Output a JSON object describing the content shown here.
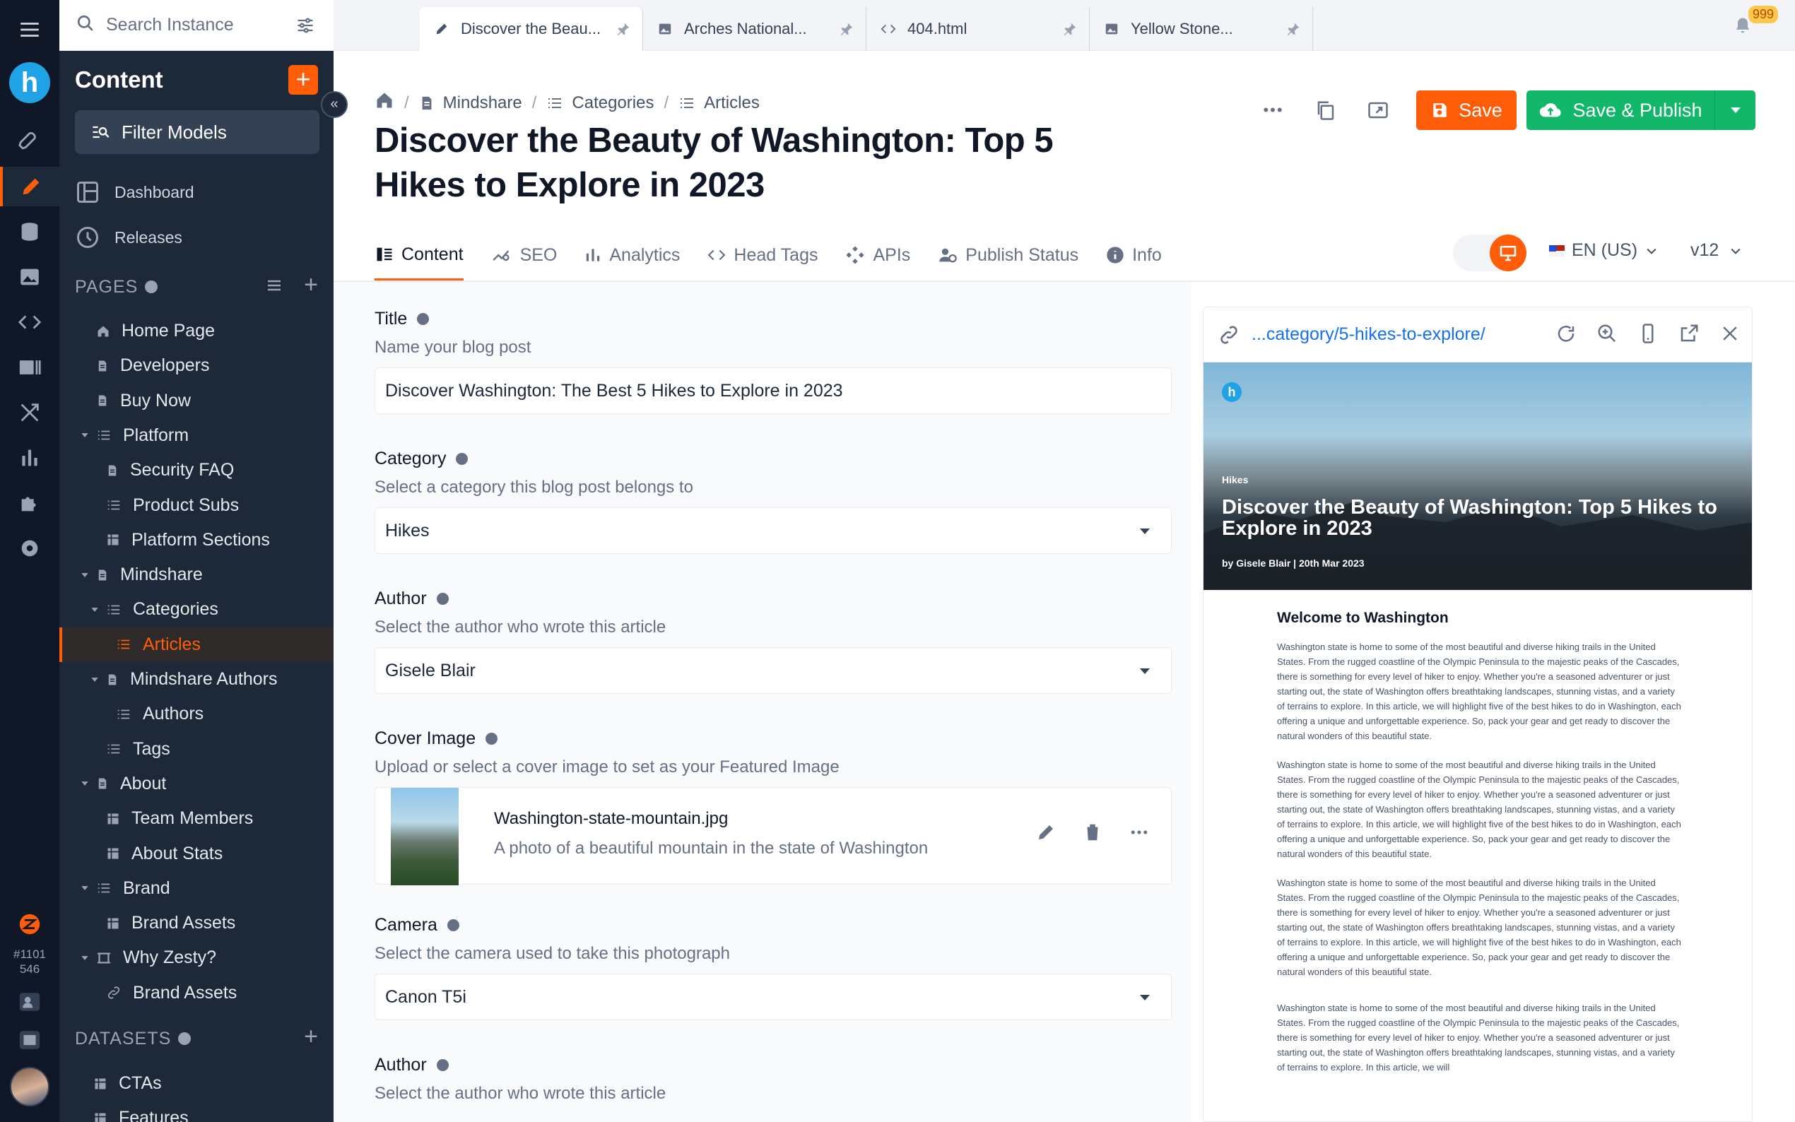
{
  "rail": {
    "instance_id": "#1101\n546"
  },
  "sidebar": {
    "search_placeholder": "Search Instance",
    "content_title": "Content",
    "add_label": "+",
    "filter_models": "Filter Models",
    "links": [
      {
        "label": "Dashboard",
        "icon": "dashboard-icon"
      },
      {
        "label": "Releases",
        "icon": "history-icon"
      }
    ],
    "pages_heading": "PAGES",
    "tree": [
      {
        "label": "Home Page",
        "icon": "home-icon",
        "depth": 0
      },
      {
        "label": "Developers",
        "icon": "file-icon",
        "depth": 0
      },
      {
        "label": "Buy Now",
        "icon": "file-icon",
        "depth": 0
      },
      {
        "label": "Platform",
        "icon": "list-icon",
        "depth": 0,
        "expanded": true
      },
      {
        "label": "Security FAQ",
        "icon": "file-icon",
        "depth": 1
      },
      {
        "label": "Product Subs",
        "icon": "list-icon",
        "depth": 1
      },
      {
        "label": "Platform Sections",
        "icon": "grid-icon",
        "depth": 1
      },
      {
        "label": "Mindshare",
        "icon": "file-icon",
        "depth": 0,
        "expanded": true
      },
      {
        "label": "Categories",
        "icon": "list-icon",
        "depth": 1,
        "expanded": true
      },
      {
        "label": "Articles",
        "icon": "list-icon",
        "depth": 2,
        "active": true
      },
      {
        "label": "Mindshare Authors",
        "icon": "file-icon",
        "depth": 1,
        "expanded": true
      },
      {
        "label": "Authors",
        "icon": "list-icon",
        "depth": 2
      },
      {
        "label": "Tags",
        "icon": "list-icon",
        "depth": 1
      },
      {
        "label": "About",
        "icon": "file-icon",
        "depth": 0,
        "expanded": true
      },
      {
        "label": "Team Members",
        "icon": "grid-icon",
        "depth": 1
      },
      {
        "label": "About Stats",
        "icon": "grid-icon",
        "depth": 1
      },
      {
        "label": "Brand",
        "icon": "list-icon",
        "depth": 0,
        "expanded": true
      },
      {
        "label": "Brand Assets",
        "icon": "grid-icon",
        "depth": 1
      },
      {
        "label": "Why Zesty?",
        "icon": "frame-icon",
        "depth": 0,
        "expanded": true
      },
      {
        "label": "Brand Assets",
        "icon": "link-icon",
        "depth": 1
      }
    ],
    "datasets_heading": "DATASETS",
    "datasets": [
      {
        "label": "CTAs",
        "icon": "grid-icon"
      },
      {
        "label": "Features",
        "icon": "grid-icon"
      }
    ]
  },
  "tabs": [
    {
      "label": "Discover the Beau...",
      "icon": "pencil-icon",
      "active": true
    },
    {
      "label": "Arches National...",
      "icon": "image-icon"
    },
    {
      "label": "404.html",
      "icon": "code-icon"
    },
    {
      "label": "Yellow Stone...",
      "icon": "image-icon"
    }
  ],
  "notifications": {
    "count": "999"
  },
  "breadcrumb": [
    "Mindshare",
    "Categories",
    "Articles"
  ],
  "page_title": "Discover the Beauty of Washington: Top 5 Hikes to Explore in 2023",
  "actions": {
    "more": "•••",
    "save": "Save",
    "publish": "Save & Publish"
  },
  "content_tabs": [
    {
      "label": "Content",
      "icon": "content-icon",
      "active": true
    },
    {
      "label": "SEO",
      "icon": "seo-icon"
    },
    {
      "label": "Analytics",
      "icon": "bar-chart-icon"
    },
    {
      "label": "Head Tags",
      "icon": "code-icon"
    },
    {
      "label": "APIs",
      "icon": "api-icon"
    },
    {
      "label": "Publish Status",
      "icon": "users-icon"
    },
    {
      "label": "Info",
      "icon": "info-icon"
    }
  ],
  "language": "EN (US)",
  "version": "v12",
  "form": {
    "title": {
      "label": "Title",
      "desc": "Name your blog post",
      "value": "Discover Washington: The Best 5 Hikes to Explore in 2023"
    },
    "category": {
      "label": "Category",
      "desc": "Select a category this blog post belongs to",
      "value": "Hikes"
    },
    "author": {
      "label": "Author",
      "desc": "Select the author who wrote this article",
      "value": "Gisele Blair"
    },
    "cover": {
      "label": "Cover Image",
      "desc": "Upload or select a cover image to set as your Featured Image",
      "filename": "Washington-state-mountain.jpg",
      "caption": "A photo of a beautiful mountain in the state of Washington"
    },
    "camera": {
      "label": "Camera",
      "desc": "Select the camera used to take this photograph",
      "value": "Canon T5i"
    },
    "author2": {
      "label": "Author",
      "desc": "Select the author who wrote this article"
    }
  },
  "preview": {
    "url": "...category/5-hikes-to-explore/",
    "hero_category": "Hikes",
    "hero_title": "Discover the Beauty of Washington: Top 5 Hikes to Explore in 2023",
    "hero_byline": "by Gisele Blair | 20th Mar 2023",
    "article_heading": "Welcome to Washington",
    "paragraph": "Washington state is home to some of the most beautiful and diverse hiking trails in the United States. From the rugged coastline of the Olympic Peninsula to the majestic peaks of the Cascades, there is something for every level of hiker to enjoy. Whether you're a seasoned adventurer or just starting out, the state of Washington offers breathtaking landscapes, stunning vistas, and a variety of terrains to explore. In this article, we will highlight five of the best hikes to do in Washington, each offering a unique and unforgettable experience. So, pack your gear and get ready to discover the natural wonders of this beautiful state.",
    "paragraph_short": "Washington state is home to some of the most beautiful and diverse hiking trails in the United States. From the rugged coastline of the Olympic Peninsula to the majestic peaks of the Cascades, there is something for every level of hiker to enjoy. Whether you're a seasoned adventurer or just starting out, the state of Washington offers breathtaking landscapes, stunning vistas, and a variety of terrains to explore. In this article, we will"
  }
}
